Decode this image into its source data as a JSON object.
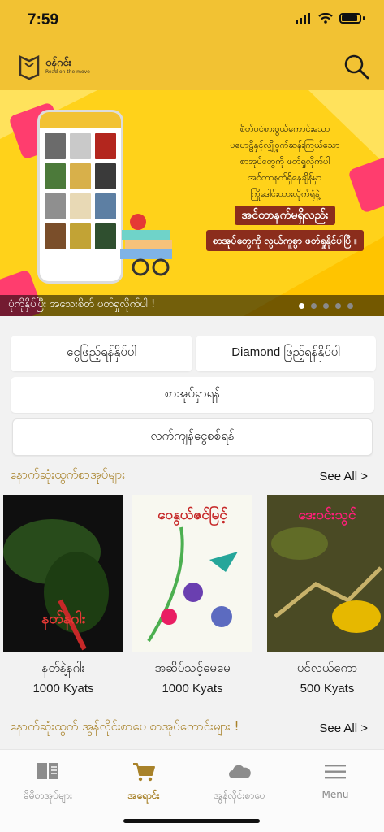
{
  "status_bar": {
    "time": "7:59"
  },
  "app": {
    "logo_title": "ဝန်ဂင်း",
    "logo_subtitle": "Read on the move"
  },
  "banner": {
    "lines": [
      "စိတ်ဝင်စားဖွယ်ကောင်းသော",
      "ပဟေဠိနှင့်လျှို့ဝှက်ဆန်းကြယ်သော",
      "စာအုပ်တွေကို ဖတ်ရှုလိုက်ပါ",
      "အင်တာနက်ရှိနေချိန်မှာ",
      "ကြိုဒေါင်းထားလိုက်ရုံနဲ့"
    ],
    "headline": "အင်တာနက်မရှိလည်း",
    "subheadline": "စာအုပ်တွေကို လွယ်ကူစွာ ဖတ်ရှုနိုင်ပါပြီ ။",
    "caption": "ပုံကိုနှိပ်ပြီး အသေးစိတ် ဖတ်ရှုလိုက်ပါ !",
    "dots_total": 5,
    "dots_active": 1
  },
  "actions": {
    "balance": "ငွေဖြည့်ရန်နှိပ်ပါ",
    "diamond": "Diamond ဖြည့်ရန်နှိပ်ပါ",
    "search_books": "စာအုပ်ရှာရန်",
    "remaining_balance": "လက်ကျန်ငွေစစ်ရန်"
  },
  "latest_books": {
    "title": "နောက်ဆုံးထွက်စာအုပ်များ",
    "see_all": "See All >",
    "items": [
      {
        "title": "နတ်နဲ့နဂါး",
        "price": "1000 Kyats",
        "cover_text": "နတ်နဂါး"
      },
      {
        "title": "အဆိပ်သင့်မေမေ",
        "price": "1000 Kyats",
        "cover_text": "ဝေနွယ်ဇင်မြင့်"
      },
      {
        "title": "ပင်လယ်ကော",
        "price": "500 Kyats",
        "cover_text": "ဒေးဝင်းသွင်"
      }
    ]
  },
  "latest_webtoon": {
    "title": "နောက်ဆုံးထွက် အွန်လိုင်းစာပေ စာအုပ်ကောင်းများ !",
    "see_all": "See All >"
  },
  "tabbar": {
    "tabs": [
      {
        "label": "မိမိစာအုပ်များ",
        "icon": "book-icon"
      },
      {
        "label": "အရောင်း",
        "icon": "cart-icon"
      },
      {
        "label": "အွန်လိုင်းစာပေ",
        "icon": "cloud-icon"
      },
      {
        "label": "Menu",
        "icon": "menu-icon"
      }
    ],
    "active_index": 1
  },
  "colors": {
    "header": "#f2c233",
    "accent": "#a8822a",
    "banner": "#ffd21a"
  }
}
